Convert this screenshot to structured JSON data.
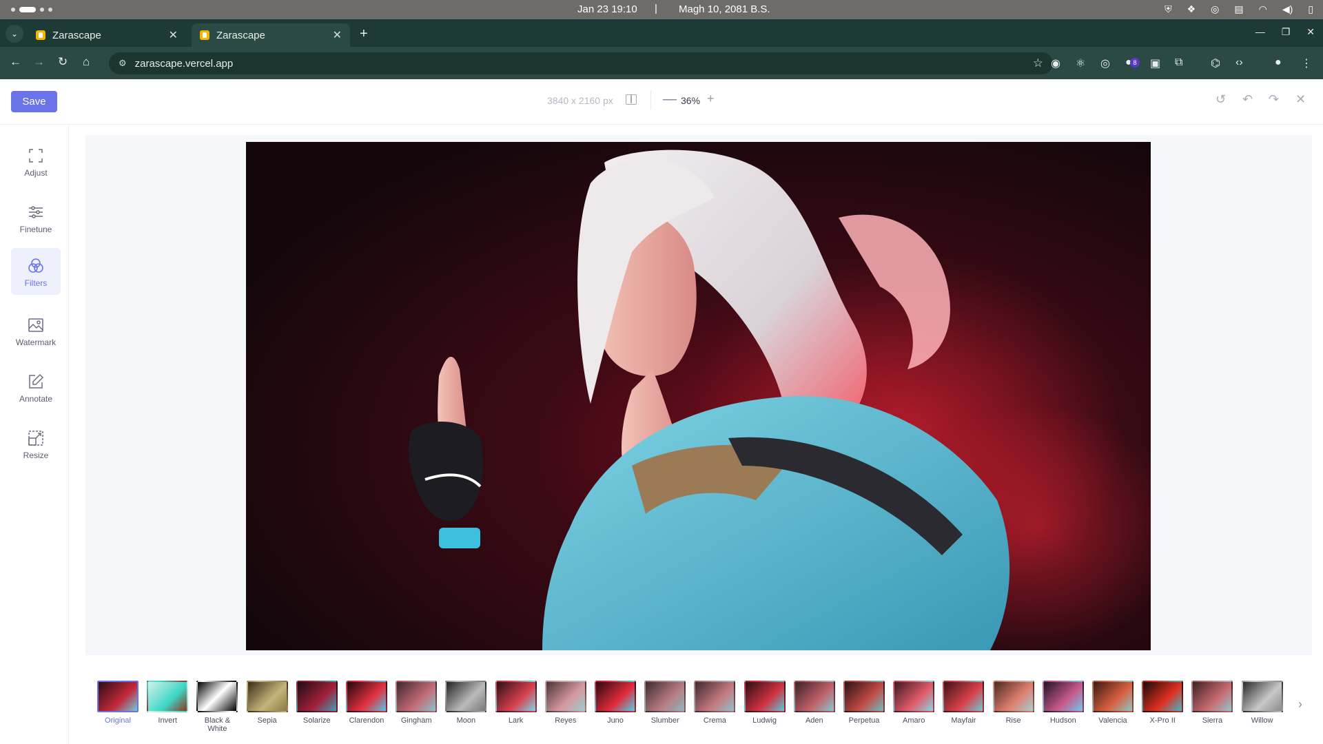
{
  "os": {
    "clock": "Jan 23  19:10",
    "separator": "|",
    "nepali_date": "Magh 10, 2081 B.S."
  },
  "browser": {
    "tabs": [
      {
        "label": "Zarascape",
        "active": false
      },
      {
        "label": "Zarascape",
        "active": true
      }
    ],
    "url": "zarascape.vercel.app",
    "extension_badge": "8"
  },
  "header": {
    "save_label": "Save",
    "dimensions": "3840 x 2160 px",
    "zoom": "36%"
  },
  "sidebar": {
    "items": [
      {
        "label": "Adjust",
        "icon": "crop-frame-icon",
        "active": false
      },
      {
        "label": "Finetune",
        "icon": "sliders-icon",
        "active": false
      },
      {
        "label": "Filters",
        "icon": "filters-circles-icon",
        "active": true
      },
      {
        "label": "Watermark",
        "icon": "image-icon",
        "active": false
      },
      {
        "label": "Annotate",
        "icon": "edit-icon",
        "active": false
      },
      {
        "label": "Resize",
        "icon": "resize-icon",
        "active": false
      }
    ]
  },
  "filters": {
    "selected": "Original",
    "items": [
      "Original",
      "Invert",
      "Black & White",
      "Sepia",
      "Solarize",
      "Clarendon",
      "Gingham",
      "Moon",
      "Lark",
      "Reyes",
      "Juno",
      "Slumber",
      "Crema",
      "Ludwig",
      "Aden",
      "Perpetua",
      "Amaro",
      "Mayfair",
      "Rise",
      "Hudson",
      "Valencia",
      "X-Pro II",
      "Sierra",
      "Willow"
    ]
  },
  "colors": {
    "accent": "#6b73e9",
    "browser_bg": "#2c4a45",
    "os_bar": "#6d6c69"
  }
}
